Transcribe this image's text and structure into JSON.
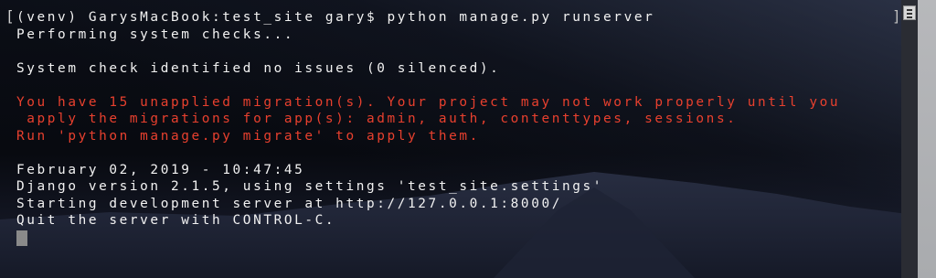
{
  "terminal": {
    "lines": [
      {
        "text": "(venv) GarysMacBook:test_site gary$ python manage.py runserver",
        "kind": "normal"
      },
      {
        "text": "Performing system checks...",
        "kind": "normal"
      },
      {
        "text": "",
        "kind": "blank"
      },
      {
        "text": "System check identified no issues (0 silenced).",
        "kind": "normal"
      },
      {
        "text": "",
        "kind": "blank"
      },
      {
        "text": "You have 15 unapplied migration(s). Your project may not work properly until you",
        "kind": "warn"
      },
      {
        "text": " apply the migrations for app(s): admin, auth, contenttypes, sessions.",
        "kind": "warn"
      },
      {
        "text": "Run 'python manage.py migrate' to apply them.",
        "kind": "warn"
      },
      {
        "text": "",
        "kind": "blank"
      },
      {
        "text": "February 02, 2019 - 10:47:45",
        "kind": "normal"
      },
      {
        "text": "Django version 2.1.5, using settings 'test_site.settings'",
        "kind": "normal"
      },
      {
        "text": "Starting development server at http://127.0.0.1:8000/",
        "kind": "normal"
      },
      {
        "text": "Quit the server with CONTROL-C.",
        "kind": "normal"
      }
    ],
    "colors": {
      "text": "#f2f2f2",
      "warning": "#e8402e",
      "cursor": "#8a8a8a",
      "background": "#0a0d14"
    },
    "icons": {
      "scroll_button": "menu-lines-icon"
    }
  }
}
